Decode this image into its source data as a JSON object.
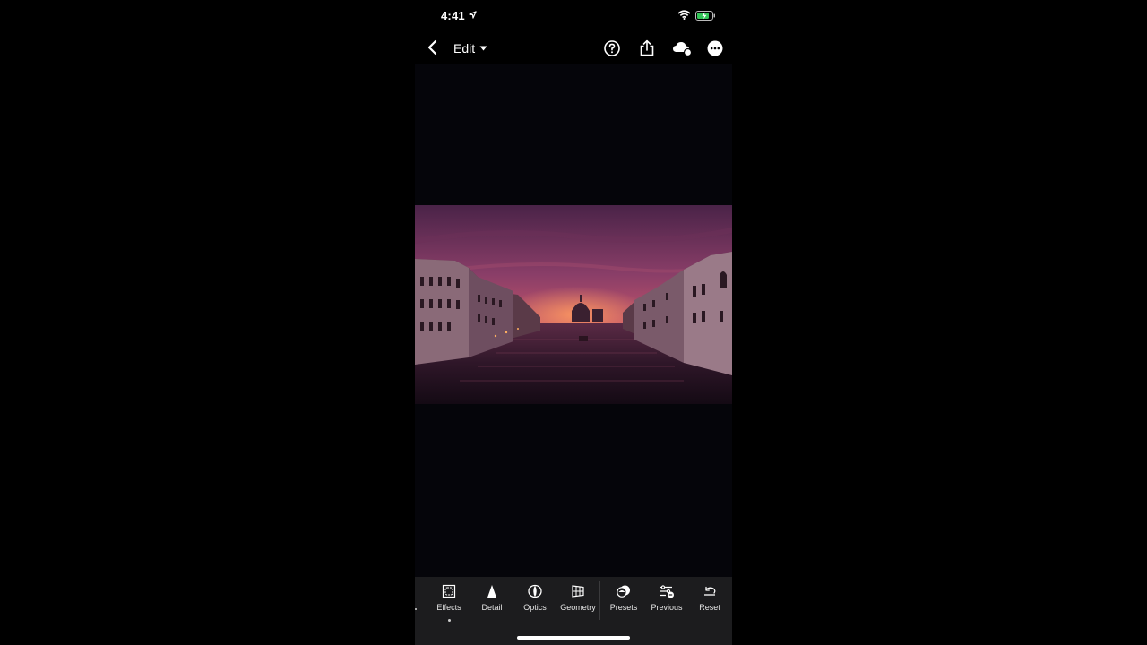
{
  "status_bar": {
    "time": "4:41",
    "icons": [
      "location-arrow-icon",
      "wifi-icon",
      "battery-charging-icon"
    ],
    "battery_color": "#34c759"
  },
  "top_bar": {
    "edit_label": "Edit",
    "icons": [
      "back-chevron-icon",
      "caret-down-icon",
      "help-icon",
      "share-icon",
      "cloud-sync-icon",
      "more-icon"
    ]
  },
  "toolbar": {
    "tools": [
      {
        "label": "Effects",
        "icon": "effects-icon"
      },
      {
        "label": "Detail",
        "icon": "detail-icon"
      },
      {
        "label": "Optics",
        "icon": "optics-icon"
      },
      {
        "label": "Geometry",
        "icon": "geometry-icon"
      },
      {
        "label": "Presets",
        "icon": "presets-icon"
      },
      {
        "label": "Previous",
        "icon": "previous-icon"
      },
      {
        "label": "Reset",
        "icon": "reset-icon"
      }
    ]
  },
  "colors": {
    "background": "#000000",
    "canvas": "#05050a",
    "toolbar": "#1c1c1e",
    "sky_top": "#5a2a55",
    "sky_glow": "#e07a6e"
  }
}
